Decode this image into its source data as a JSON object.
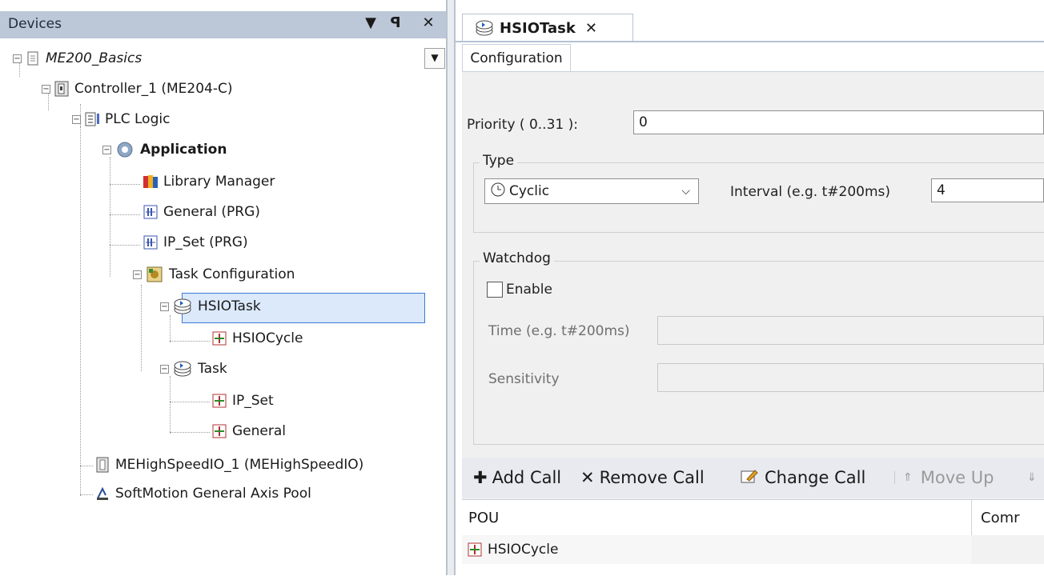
{
  "devices_panel": {
    "title": "Devices",
    "buttons": {
      "dropdown": "▾",
      "pin": "ᵖ",
      "close": "✕"
    },
    "tree": {
      "project": "ME200_Basics",
      "controller": "Controller_1 (ME204-C)",
      "plc_logic": "PLC Logic",
      "application": "Application",
      "library_manager": "Library Manager",
      "general_prg": "General (PRG)",
      "ip_set_prg": "IP_Set (PRG)",
      "task_configuration": "Task Configuration",
      "hsio_task": "HSIOTask",
      "hsio_cycle": "HSIOCycle",
      "task": "Task",
      "ip_set": "IP_Set",
      "general": "General",
      "mehighspeed": "MEHighSpeedIO_1 (MEHighSpeedIO)",
      "softmotion": "SoftMotion General Axis Pool"
    }
  },
  "editor": {
    "doc_tab": {
      "label": "HSIOTask",
      "close": "✕"
    },
    "config_tab": "Configuration",
    "priority": {
      "label": "Priority ( 0..31 ):",
      "value": "0"
    },
    "type_group": {
      "title": "Type",
      "selected": "Cyclic",
      "interval_label": "Interval (e.g. t#200ms)",
      "interval_value": "4"
    },
    "watchdog_group": {
      "title": "Watchdog",
      "enable_label": "Enable",
      "enabled": false,
      "time_label": "Time (e.g. t#200ms)",
      "sensitivity_label": "Sensitivity"
    },
    "toolbar": {
      "add_call": "Add Call",
      "remove_call": "Remove Call",
      "change_call": "Change Call",
      "move_up": "Move Up"
    },
    "table": {
      "columns": [
        "POU",
        "Comr"
      ],
      "rows": [
        {
          "pou": "HSIOCycle"
        }
      ]
    }
  },
  "colors": {
    "header_bg": "#bcc7d8",
    "selection": "#3a7bd5",
    "accent_gold": "#d4a21c"
  }
}
